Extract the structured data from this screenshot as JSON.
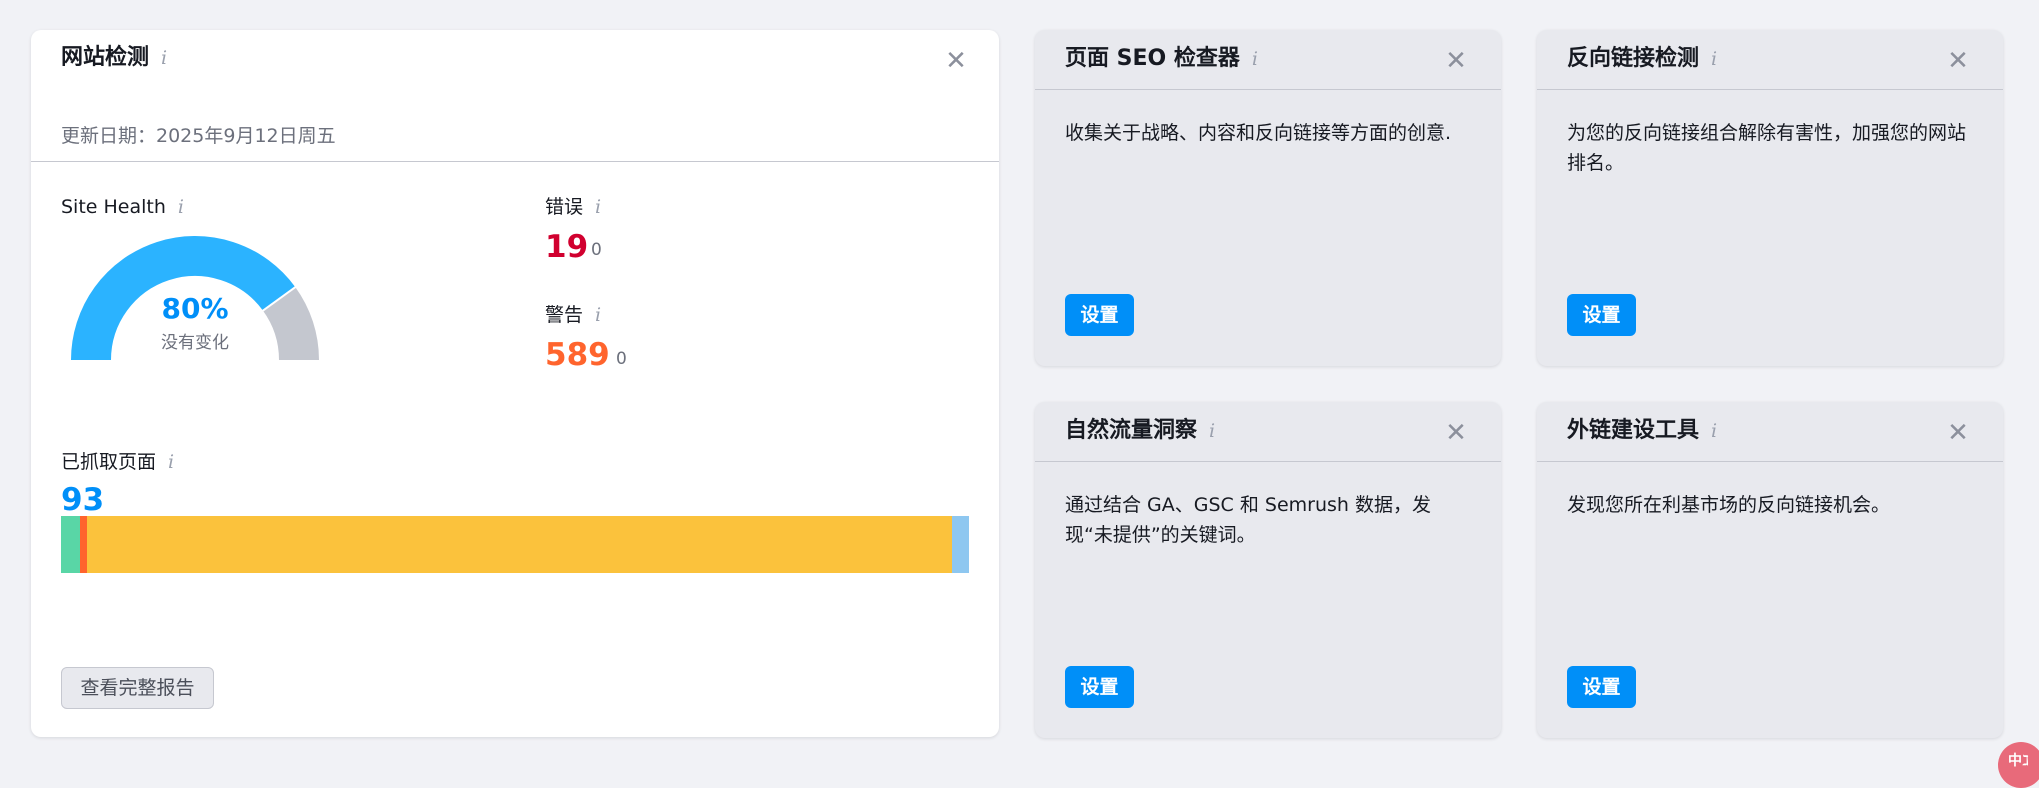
{
  "site_audit": {
    "title": "网站检测",
    "updated": "更新日期：2025年9月12日周五",
    "site_health": {
      "label": "Site Health",
      "percent": 80,
      "percent_text": "80%",
      "change": "没有变化"
    },
    "errors": {
      "label": "错误",
      "value": "19",
      "delta": "0"
    },
    "warnings": {
      "label": "警告",
      "value": "589",
      "delta": "0"
    },
    "crawled": {
      "label": "已抓取页面",
      "value": "93"
    },
    "crawl_bar": [
      {
        "name": "healthy",
        "fraction": 0.021,
        "color": "#59d6a6"
      },
      {
        "name": "broken",
        "fraction": 0.0075,
        "color": "#ff642d"
      },
      {
        "name": "have-issues",
        "fraction": 0.953,
        "color": "#fbc23c"
      },
      {
        "name": "redirects",
        "fraction": 0.0185,
        "color": "#8ec7f0"
      }
    ],
    "full_report_button": "查看完整报告"
  },
  "promo_cards": [
    {
      "title": "页面 SEO 检查器",
      "desc": "收集关于战略、内容和反向链接等方面的创意.",
      "button": "设置"
    },
    {
      "title": "反向链接检测",
      "desc": "为您的反向链接组合解除有害性，加强您的网站排名。",
      "button": "设置"
    },
    {
      "title": "自然流量洞察",
      "desc": "通过结合 GA、GSC 和 Semrush 数据，发现“未提供”的关键词。",
      "button": "设置"
    },
    {
      "title": "外链建设工具",
      "desc": "发现您所在利基市场的反向链接机会。",
      "button": "设置"
    }
  ],
  "icons": {
    "info": "i",
    "close": "✕"
  },
  "colors": {
    "accent": "#008ff8",
    "error": "#d1002f",
    "warning": "#ff642d",
    "gauge_fill": "#2bb3ff",
    "gauge_track": "#c4c7cf"
  },
  "corner_badge": "中ℷ"
}
